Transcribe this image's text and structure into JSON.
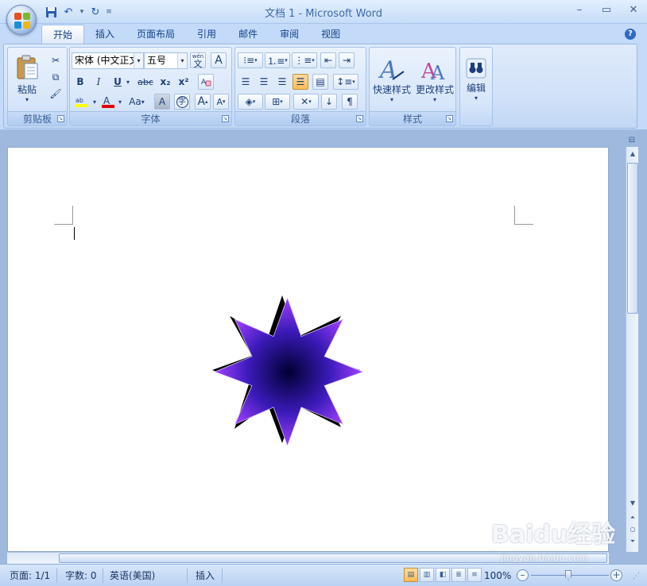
{
  "window": {
    "title": "文档 1 - Microsoft Word",
    "controls": [
      "–",
      "▭",
      "✕"
    ]
  },
  "tabs": [
    {
      "label": "开始",
      "active": true
    },
    {
      "label": "插入"
    },
    {
      "label": "页面布局"
    },
    {
      "label": "引用"
    },
    {
      "label": "邮件"
    },
    {
      "label": "审阅"
    },
    {
      "label": "视图"
    }
  ],
  "ribbon": {
    "clipboard": {
      "label": "剪贴板",
      "paste": "粘贴"
    },
    "font": {
      "label": "字体",
      "font_name": "宋体 (中文正文",
      "font_size": "五号",
      "bold": "B",
      "italic": "I",
      "underline": "U",
      "strike": "abc",
      "subscript": "x₂",
      "superscript": "x²",
      "grow": "A",
      "shrink": "A",
      "change_case": "Aa",
      "char_shade": "A",
      "enclose": "字",
      "phonetic": "wén",
      "phonetic_char": "文",
      "border": "A"
    },
    "paragraph": {
      "label": "段落"
    },
    "styles": {
      "label": "样式",
      "quick_styles": "快速样式",
      "change_styles": "更改样式"
    },
    "editing": {
      "label": "编辑"
    }
  },
  "status": {
    "page": "页面: 1/1",
    "words": "字数: 0",
    "language": "英语(美国)",
    "mode": "插入",
    "zoom": "100%",
    "zoom_minus": "–",
    "zoom_plus": "+"
  },
  "colors": {
    "star_center": "#000033",
    "star_mid": "#3a1ab8",
    "star_edge": "#a040ff",
    "shadow": "#000000"
  },
  "watermark": {
    "text": "Baidu经验",
    "sub": "jingyan.baidu.com"
  }
}
